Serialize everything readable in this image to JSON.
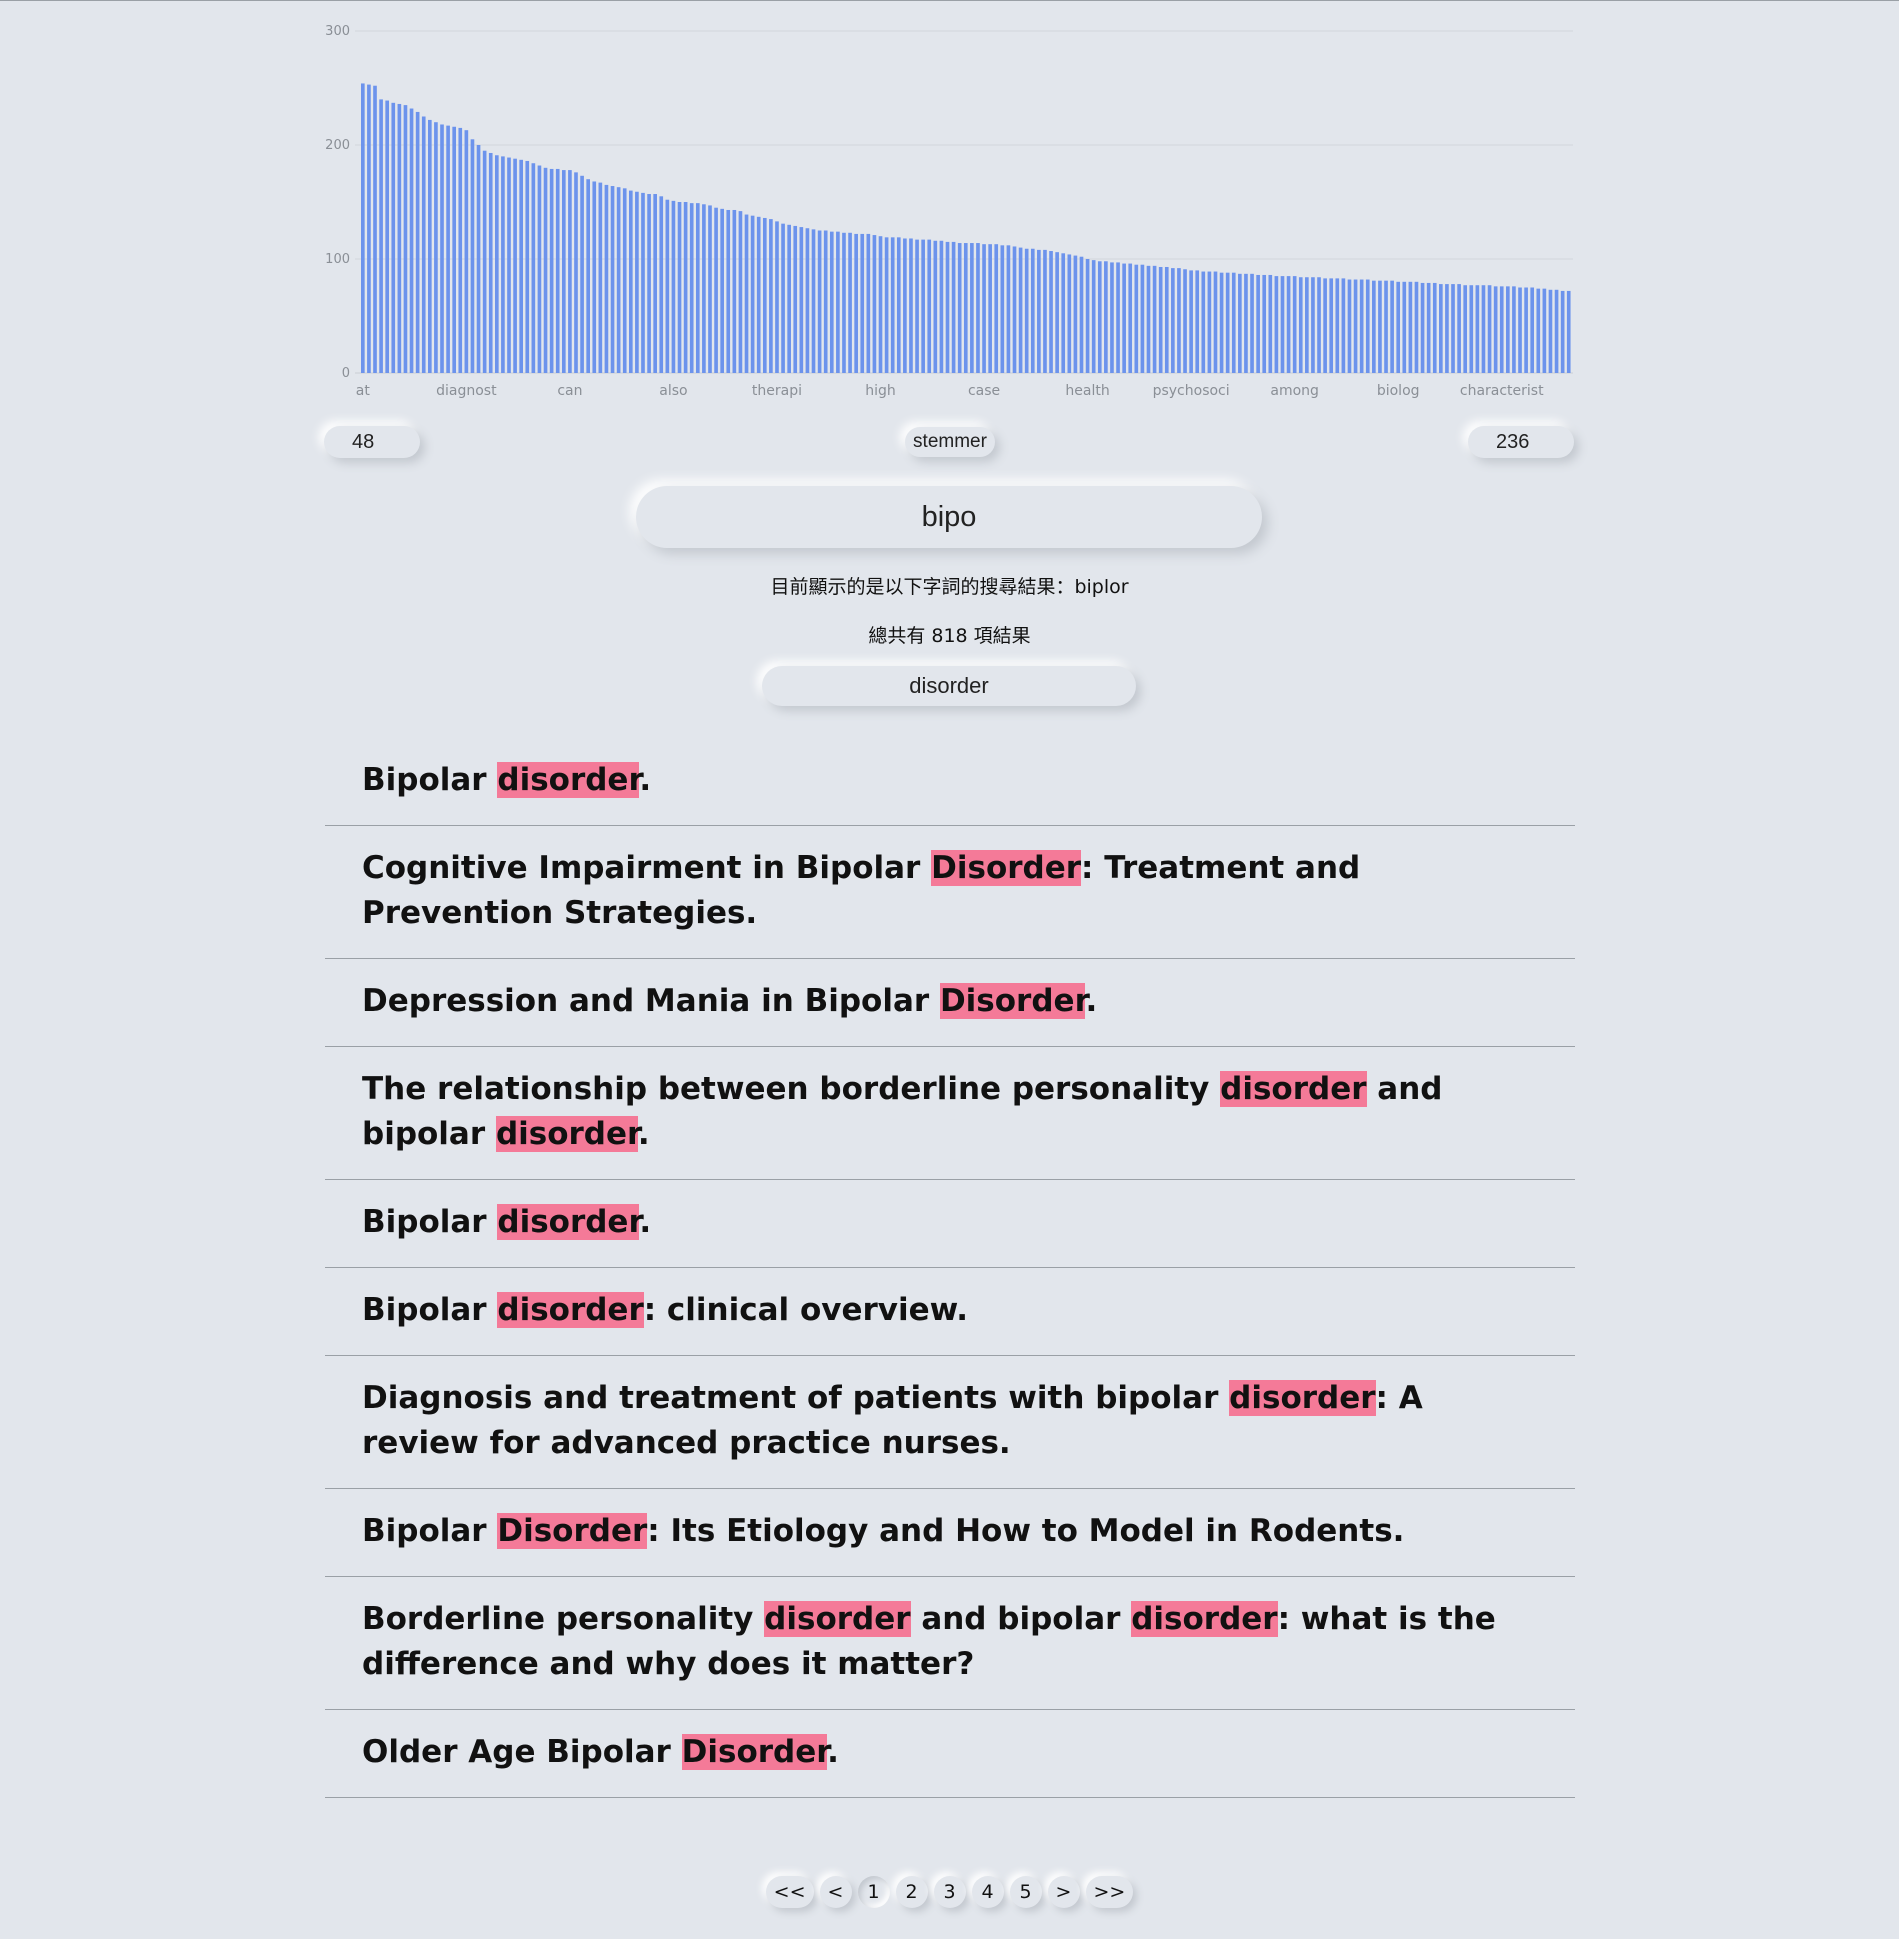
{
  "chart_data": {
    "type": "bar",
    "ylim": [
      0,
      300
    ],
    "yticks": [
      0,
      100,
      200,
      300
    ],
    "bar_color": "#6c93ec",
    "tick_labels": [
      "at",
      "diagnost",
      "can",
      "also",
      "therapi",
      "high",
      "case",
      "health",
      "psychosoci",
      "among",
      "biolog",
      "characterist"
    ],
    "values": [
      254,
      253,
      252,
      240,
      239,
      237,
      236,
      235,
      232,
      229,
      225,
      222,
      220,
      218,
      217,
      216,
      215,
      213,
      205,
      200,
      195,
      193,
      191,
      190,
      189,
      188,
      187,
      186,
      184,
      182,
      180,
      179,
      179,
      178,
      178,
      176,
      173,
      170,
      168,
      167,
      165,
      164,
      163,
      162,
      160,
      159,
      158,
      157,
      157,
      155,
      152,
      151,
      150,
      150,
      149,
      149,
      148,
      147,
      145,
      144,
      143,
      143,
      142,
      139,
      138,
      137,
      136,
      135,
      133,
      131,
      130,
      129,
      128,
      127,
      126,
      125,
      125,
      124,
      124,
      123,
      123,
      122,
      122,
      122,
      121,
      120,
      119,
      119,
      119,
      118,
      118,
      117,
      117,
      117,
      116,
      116,
      115,
      115,
      114,
      114,
      114,
      114,
      113,
      113,
      113,
      112,
      112,
      111,
      110,
      109,
      109,
      108,
      108,
      107,
      106,
      105,
      104,
      103,
      102,
      100,
      99,
      98,
      98,
      97,
      97,
      96,
      96,
      95,
      95,
      94,
      94,
      93,
      93,
      92,
      92,
      91,
      90,
      90,
      89,
      89,
      89,
      88,
      88,
      88,
      87,
      87,
      87,
      86,
      86,
      86,
      85,
      85,
      85,
      85,
      84,
      84,
      84,
      84,
      83,
      83,
      83,
      83,
      82,
      82,
      82,
      82,
      81,
      81,
      81,
      81,
      80,
      80,
      80,
      80,
      79,
      79,
      79,
      78,
      78,
      78,
      78,
      77,
      77,
      77,
      77,
      77,
      76,
      76,
      76,
      76,
      75,
      75,
      75,
      74,
      74,
      73,
      73,
      72,
      72
    ]
  },
  "controls": {
    "min_value": "48",
    "stemmer_label": "stemmer",
    "max_value": "236"
  },
  "search": {
    "query": "bipo",
    "suggestion_text": "目前顯示的是以下字詞的搜尋結果：biplor",
    "count_text": "總共有 818 項結果",
    "filter_term": "disorder"
  },
  "highlight_color": "#f47a98",
  "results": [
    {
      "parts": [
        {
          "t": "Bipolar "
        },
        {
          "t": "disorder",
          "h": true
        },
        {
          "t": "."
        }
      ]
    },
    {
      "parts": [
        {
          "t": "Cognitive Impairment in Bipolar "
        },
        {
          "t": "Disorder",
          "h": true
        },
        {
          "t": ": Treatment and Prevention Strategies."
        }
      ]
    },
    {
      "parts": [
        {
          "t": "Depression and Mania in Bipolar "
        },
        {
          "t": "Disorder",
          "h": true
        },
        {
          "t": "."
        }
      ]
    },
    {
      "parts": [
        {
          "t": "The relationship between borderline personality "
        },
        {
          "t": "disorder",
          "h": true
        },
        {
          "t": " and bipolar "
        },
        {
          "t": "disorder",
          "h": true
        },
        {
          "t": "."
        }
      ]
    },
    {
      "parts": [
        {
          "t": "Bipolar "
        },
        {
          "t": "disorder",
          "h": true
        },
        {
          "t": "."
        }
      ]
    },
    {
      "parts": [
        {
          "t": "Bipolar "
        },
        {
          "t": "disorder",
          "h": true
        },
        {
          "t": ": clinical overview."
        }
      ]
    },
    {
      "parts": [
        {
          "t": "Diagnosis and treatment of patients with bipolar "
        },
        {
          "t": "disorder",
          "h": true
        },
        {
          "t": ": A review for advanced practice nurses."
        }
      ]
    },
    {
      "parts": [
        {
          "t": "Bipolar "
        },
        {
          "t": "Disorder",
          "h": true
        },
        {
          "t": ": Its Etiology and How to Model in Rodents."
        }
      ]
    },
    {
      "parts": [
        {
          "t": "Borderline personality "
        },
        {
          "t": "disorder",
          "h": true
        },
        {
          "t": " and bipolar "
        },
        {
          "t": "disorder",
          "h": true
        },
        {
          "t": ": what is the difference and why does it matter?"
        }
      ]
    },
    {
      "parts": [
        {
          "t": "Older Age Bipolar "
        },
        {
          "t": "Disorder",
          "h": true
        },
        {
          "t": "."
        }
      ]
    }
  ],
  "pagination": {
    "first": "<<",
    "prev": "<",
    "pages": [
      "1",
      "2",
      "3",
      "4",
      "5"
    ],
    "current": "1",
    "next": ">",
    "last": ">>"
  }
}
